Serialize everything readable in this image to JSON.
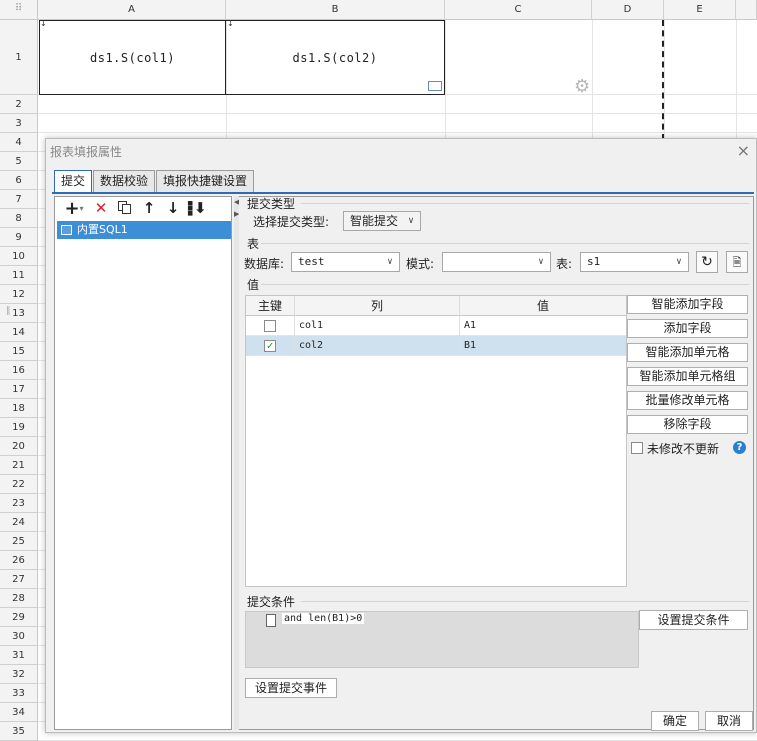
{
  "sheet": {
    "columns": [
      "A",
      "B",
      "C",
      "D",
      "E"
    ],
    "rows": [
      "1",
      "2",
      "3",
      "4",
      "5",
      "6",
      "7",
      "8",
      "9",
      "10",
      "11",
      "12",
      "13",
      "14",
      "15",
      "16",
      "17",
      "18",
      "19",
      "20",
      "21",
      "22",
      "23",
      "24",
      "25",
      "26",
      "27",
      "28",
      "29",
      "30",
      "31",
      "32",
      "33",
      "34",
      "35"
    ],
    "cells": {
      "a1": "ds1.S(col1)",
      "b1": "ds1.S(col2)"
    }
  },
  "dialog": {
    "title": "报表填报属性",
    "close": "×",
    "tabs": [
      "提交",
      "数据校验",
      "填报快捷键设置"
    ],
    "toolbar_glyphs": {
      "add": "+",
      "add_arrow": "▾",
      "delete": "✕",
      "up": "↑",
      "down": "↓"
    },
    "tree_item": "内置SQL1",
    "submit_type": {
      "section": "提交类型",
      "label": "选择提交类型:",
      "value": "智能提交"
    },
    "table_section": {
      "section": "表",
      "db_label": "数据库:",
      "db_value": "test",
      "mode_label": "模式:",
      "mode_value": "",
      "table_label": "表:",
      "table_value": "s1"
    },
    "values_section": {
      "section": "值",
      "headers": [
        "主键",
        "列",
        "值"
      ],
      "rows": [
        {
          "key": false,
          "col": "col1",
          "val": "A1"
        },
        {
          "key": true,
          "col": "col2",
          "val": "B1"
        }
      ],
      "buttons": [
        "智能添加字段",
        "添加字段",
        "智能添加单元格",
        "智能添加单元格组",
        "批量修改单元格",
        "移除字段"
      ],
      "no_update_label": "未修改不更新"
    },
    "condition": {
      "section": "提交条件",
      "expr": "and len(B1)>0",
      "set_button": "设置提交条件"
    },
    "event_button": "设置提交事件",
    "ok": "确定",
    "cancel": "取消"
  }
}
